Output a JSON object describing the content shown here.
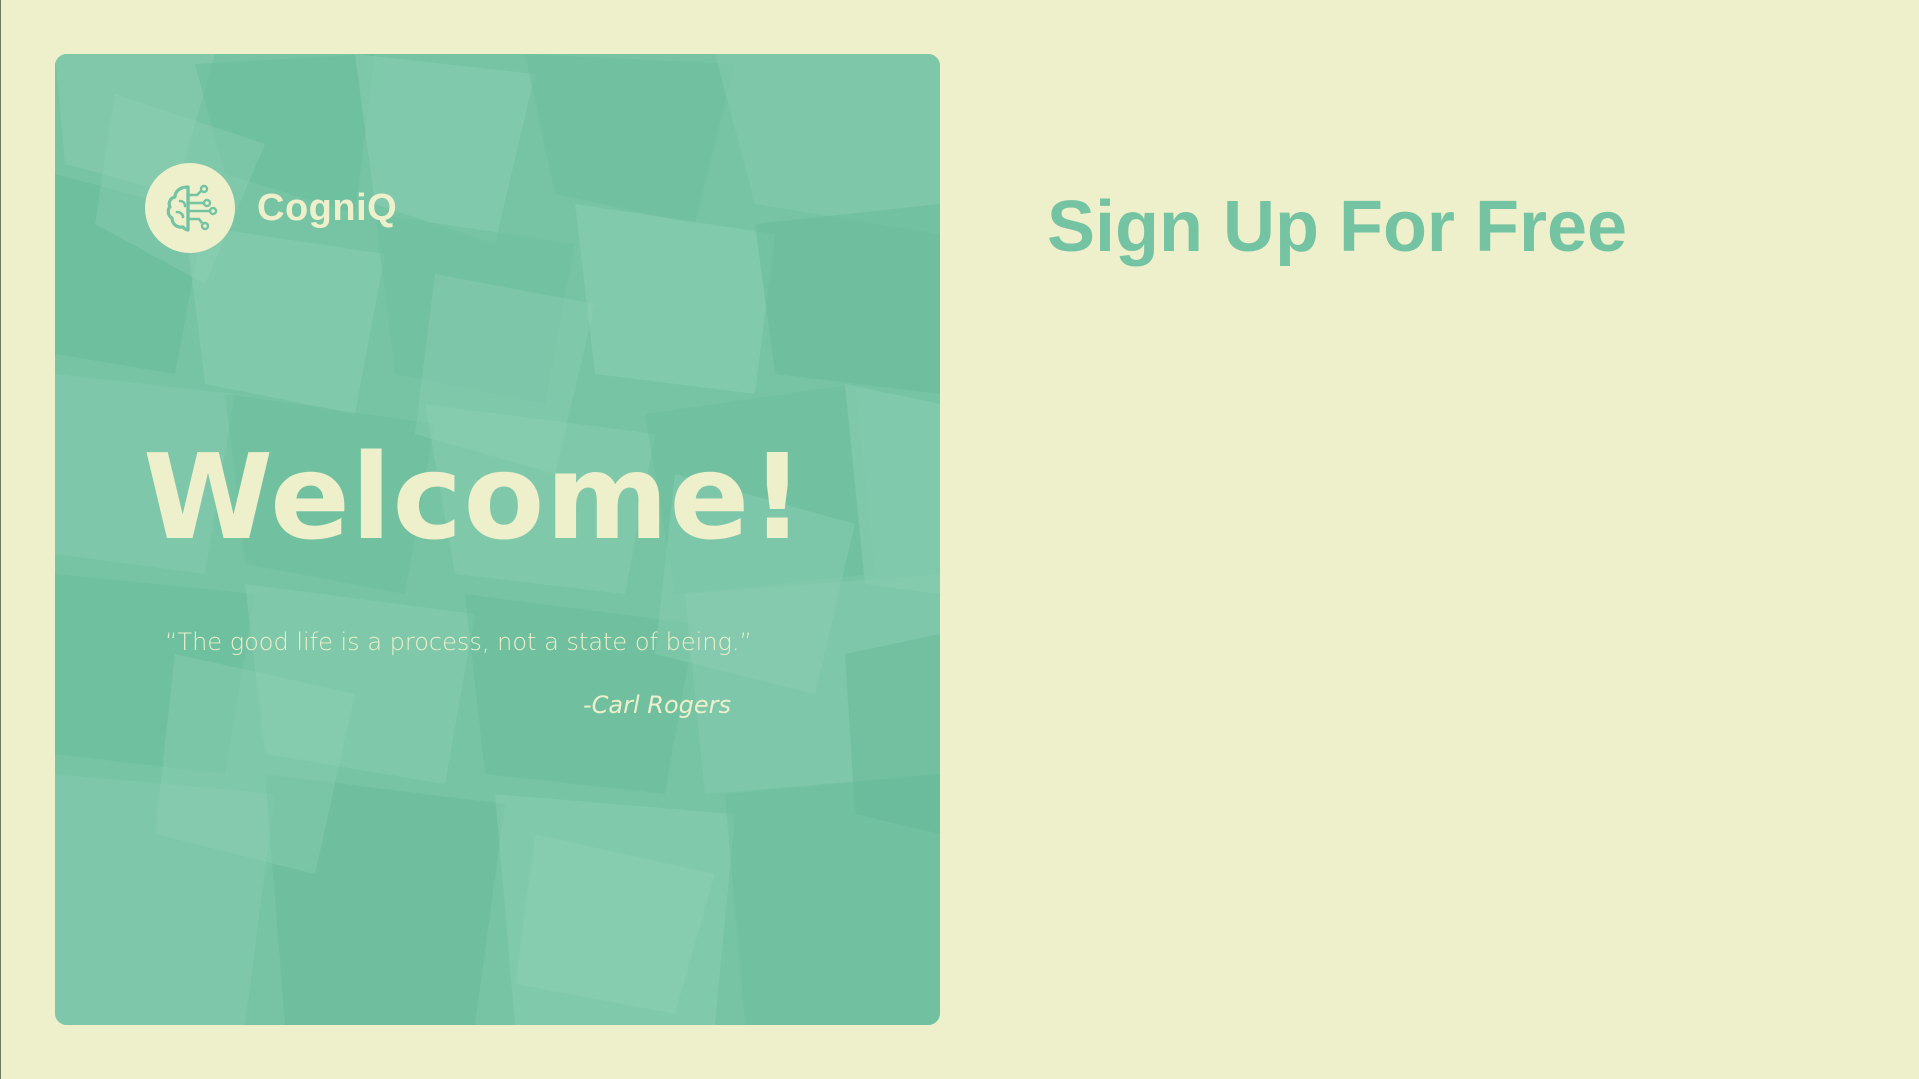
{
  "brand": {
    "name": "CogniQ",
    "logo_icon": "brain-circuit-icon"
  },
  "hero": {
    "heading": "Welcome!",
    "quote": "“The good life is a process, not a state of being.”",
    "quote_author": "-Carl Rogers"
  },
  "signup": {
    "title": "Sign Up For Free"
  },
  "colors": {
    "background": "#EEEFCB",
    "accent": "#74C3A3"
  }
}
